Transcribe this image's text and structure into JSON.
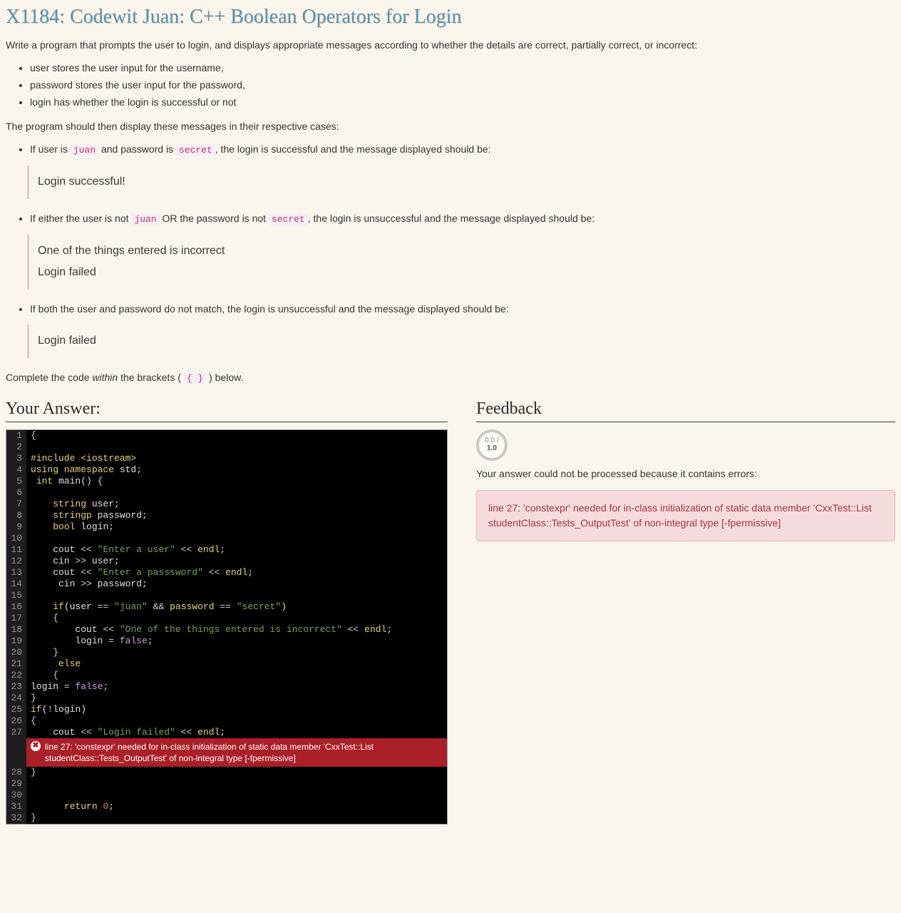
{
  "title": "X1184: Codewit Juan: C++ Boolean Operators for Login",
  "intro": "Write a program that prompts the user to login, and displays appropriate messages according to whether the details are correct, partially correct, or incorrect:",
  "vars": [
    "user stores the user input for the username,",
    "password stores the user input for the password,",
    "login has whether the login is successful or not"
  ],
  "para2": "The program should then display these messages in their respective cases:",
  "case1": {
    "pre": "If user is ",
    "code1": "juan",
    "mid": " and password is ",
    "code2": "secret",
    "post": ", the login is successful and the message displayed should be:",
    "msg": "Login successful!"
  },
  "case2": {
    "pre": "If either the user is not ",
    "code1": "juan",
    "mid": " OR the password is not ",
    "code2": "secret",
    "post": ", the login is unsuccessful and the message displayed should be:",
    "msg1": "One of the things entered is incorrect",
    "msg2": "Login failed"
  },
  "case3": {
    "text": "If both the user and password do not match, the login is unsuccessful and the message displayed should be:",
    "msg": "Login failed"
  },
  "complete": {
    "pre": "Complete the code ",
    "em": "within",
    "mid": " the brackets ( ",
    "code": "{ }",
    "post": " ) below."
  },
  "answerHeading": "Your Answer:",
  "feedbackHeading": "Feedback",
  "score": {
    "top": "0.0 /",
    "bot": "1.0"
  },
  "feedbackText": "Your answer could not be processed because it contains errors:",
  "feedbackError": "line 27: 'constexpr' needed for in-class initialization of static data member 'CxxTest::List studentClass::Tests_OutputTest' of non-integral type [-fpermissive]",
  "inlineError": "line 27: 'constexpr' needed for in-class initialization of static data member 'CxxTest::List studentClass::Tests_OutputTest' of non-integral type [-fpermissive]",
  "code": [
    {
      "n": 1,
      "html": "<span class='op'>{</span>"
    },
    {
      "n": 2,
      "html": ""
    },
    {
      "n": 3,
      "html": "<span class='kw'>#include &lt;iostream&gt;</span>"
    },
    {
      "n": 4,
      "html": "<span class='kw'>using namespace</span> std<span class='op'>;</span>"
    },
    {
      "n": 5,
      "html": " <span class='kw'>int</span> main() <span class='op'>{</span>"
    },
    {
      "n": 6,
      "html": ""
    },
    {
      "n": 7,
      "html": "    <span class='kw'>string</span> user<span class='op'>;</span>"
    },
    {
      "n": 8,
      "html": "    <span class='kw'>stringp</span> password<span class='op'>;</span>"
    },
    {
      "n": 9,
      "html": "    <span class='kw'>bool</span> login<span class='op'>;</span>"
    },
    {
      "n": 10,
      "html": ""
    },
    {
      "n": 11,
      "html": "    cout <span class='op'>&lt;&lt;</span> <span class='str'>\"Enter a user\"</span> <span class='op'>&lt;&lt;</span> <span class='kw'>endl</span><span class='op'>;</span>"
    },
    {
      "n": 12,
      "html": "    cin <span class='op'>&gt;&gt;</span> user<span class='op'>;</span>"
    },
    {
      "n": 13,
      "html": "    cout <span class='op'>&lt;&lt;</span> <span class='str'>\"Enter a passsword\"</span> <span class='op'>&lt;&lt;</span> <span class='kw'>endl</span><span class='op'>;</span>"
    },
    {
      "n": 14,
      "html": "     cin <span class='op'>&gt;&gt;</span> password<span class='op'>;</span>"
    },
    {
      "n": 15,
      "html": ""
    },
    {
      "n": 16,
      "html": "    <span class='kw'>if</span>(user <span class='op'>==</span> <span class='str'>\"juan\"</span> <span class='op'>&amp;&amp;</span> <span class='kw'>password</span> <span class='op'>==</span> <span class='str'>\"secret\"</span>)"
    },
    {
      "n": 17,
      "html": "    <span class='op'>{</span>"
    },
    {
      "n": 18,
      "html": "        cout <span class='op'>&lt;&lt;</span> <span class='str'>\"One of the things entered is incorrect\"</span> <span class='op'>&lt;&lt;</span> <span class='kw'>endl</span><span class='op'>;</span>"
    },
    {
      "n": 19,
      "html": "        login <span class='op'>=</span> <span class='bool'>false</span><span class='op'>;</span>"
    },
    {
      "n": 20,
      "html": "    <span class='op'>}</span>"
    },
    {
      "n": 21,
      "html": "     <span class='kw'>else</span>"
    },
    {
      "n": 22,
      "html": "    <span class='op'>{</span>"
    },
    {
      "n": 23,
      "html": "login <span class='op'>=</span> <span class='bool'>false</span><span class='op'>;</span>"
    },
    {
      "n": 24,
      "html": "<span class='op'>}</span>"
    },
    {
      "n": 25,
      "html": "<span class='kw'>if</span>(<span class='op'>!</span>login)"
    },
    {
      "n": 26,
      "html": "<span class='op'>{</span>"
    },
    {
      "n": 27,
      "html": "    cout <span class='op'>&lt;&lt;</span> <span class='str'>\"Login failed\"</span> <span class='op'>&lt;&lt;</span> <span class='kw'>endl</span><span class='op'>;</span>"
    },
    {
      "n": 28,
      "html": "<span class='op'>}</span>"
    },
    {
      "n": 29,
      "html": ""
    },
    {
      "n": 30,
      "html": ""
    },
    {
      "n": 31,
      "html": "      <span class='kw'>return</span> <span class='num'>0</span><span class='op'>;</span>"
    },
    {
      "n": 32,
      "html": "<span class='op'>}</span>"
    }
  ]
}
